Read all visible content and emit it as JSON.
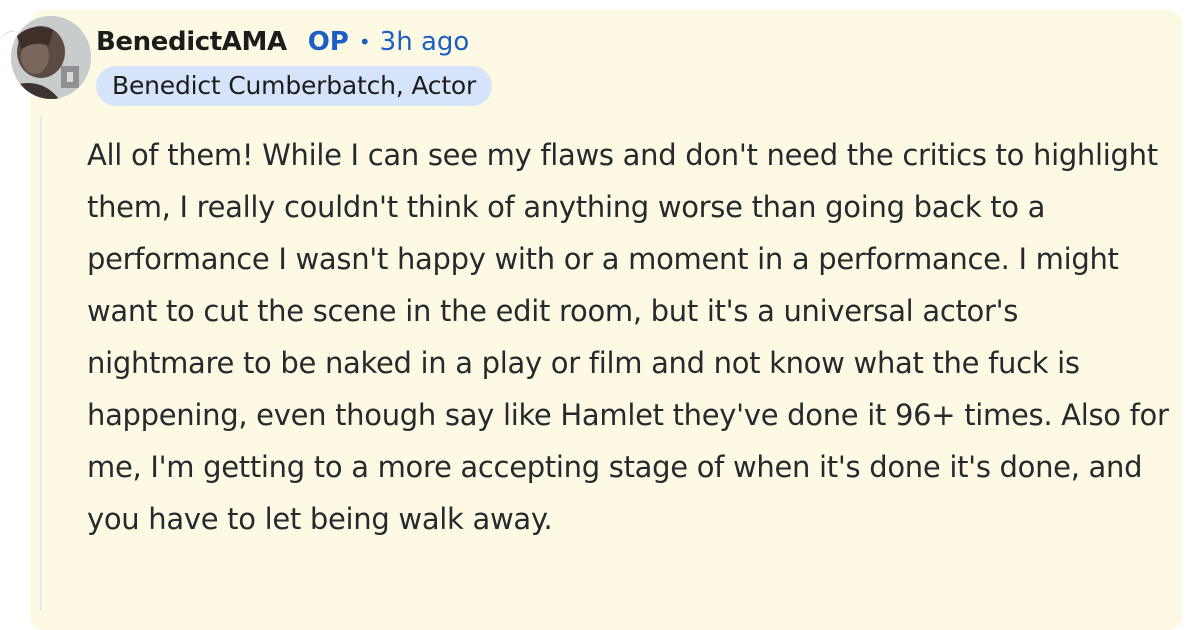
{
  "comment": {
    "username": "BenedictAMA",
    "op_label": "OP",
    "separator": "•",
    "timestamp": "3h ago",
    "flair": "Benedict Cumberbatch, Actor",
    "body": "All of them! While I can see my flaws and don't need the critics to highlight them, I really couldn't think of anything worse than going back to a performance I wasn't happy with or a moment in a performance. I might want to cut the scene in the edit room, but it's a universal actor's nightmare to be naked in a play or film and not know what the fuck is happening, even though say like Hamlet they've done it 96+ times. Also for me, I'm getting to a more accepting stage of when it's done it's done, and you have to let being walk away."
  },
  "colors": {
    "card_background": "#fef9e3",
    "accent_blue": "#1c5fc4",
    "flair_background": "#d6e4fb",
    "text": "#262a2e"
  },
  "icons": {
    "avatar": "user-avatar-photo"
  }
}
